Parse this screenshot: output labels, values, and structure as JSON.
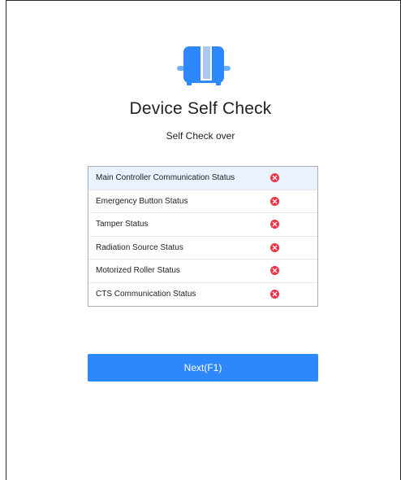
{
  "header": {
    "title": "Device Self Check",
    "subtitle": "Self Check over",
    "icon": "device-icon"
  },
  "status_items": [
    {
      "label": "Main Controller Communication Status",
      "status": "error",
      "icon": "error-icon"
    },
    {
      "label": "Emergency Button Status",
      "status": "error",
      "icon": "error-icon"
    },
    {
      "label": "Tamper Status",
      "status": "error",
      "icon": "error-icon"
    },
    {
      "label": "Radiation Source Status",
      "status": "error",
      "icon": "error-icon"
    },
    {
      "label": "Motorized Roller Status",
      "status": "error",
      "icon": "error-icon"
    },
    {
      "label": "CTS Communication Status",
      "status": "error",
      "icon": "error-icon"
    }
  ],
  "actions": {
    "next_label": "Next(F1)"
  },
  "colors": {
    "accent": "#2d88fb",
    "error": "#ea3546",
    "highlight_row": "#eaf2fd"
  }
}
